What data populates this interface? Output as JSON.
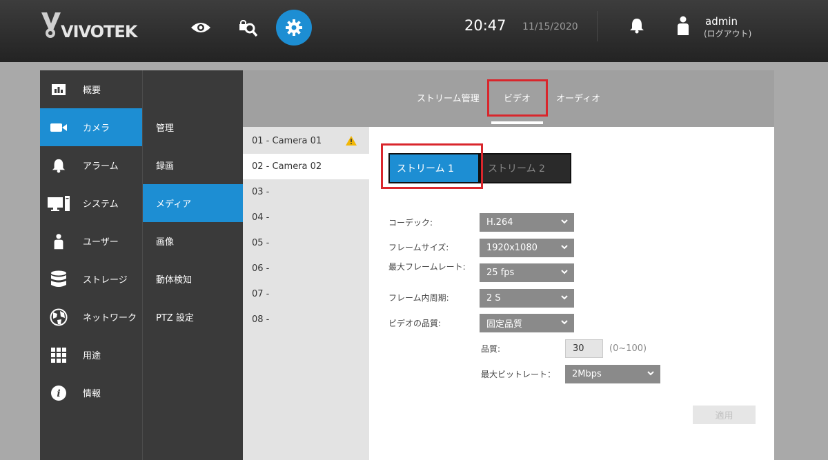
{
  "header": {
    "logo_text": "VIVOTEK",
    "time": "20:47",
    "date": "11/15/2020",
    "username": "admin",
    "logout_label": "(ログアウト)",
    "icons": [
      "eye-icon",
      "search-icon",
      "gear-icon",
      "bell-icon",
      "user-icon"
    ]
  },
  "colors": {
    "accent": "#1d8ed3",
    "highlight": "#d9262c",
    "header_bg": "#2e2e2e"
  },
  "nav_main": {
    "items": [
      {
        "label": "概要",
        "icon": "chart-icon"
      },
      {
        "label": "カメラ",
        "icon": "camera-icon"
      },
      {
        "label": "アラーム",
        "icon": "bell-icon"
      },
      {
        "label": "システム",
        "icon": "computer-icon"
      },
      {
        "label": "ユーザー",
        "icon": "user-icon"
      },
      {
        "label": "ストレージ",
        "icon": "database-icon"
      },
      {
        "label": "ネットワーク",
        "icon": "globe-icon"
      },
      {
        "label": "用途",
        "icon": "grid-icon"
      },
      {
        "label": "情報",
        "icon": "info-icon"
      }
    ],
    "active_index": 1
  },
  "nav_sub": {
    "items": [
      {
        "label": "管理"
      },
      {
        "label": "録画"
      },
      {
        "label": "メディア"
      },
      {
        "label": "画像"
      },
      {
        "label": "動体検知"
      },
      {
        "label": "PTZ 設定"
      }
    ],
    "active_index": 2
  },
  "tabs": {
    "items": [
      {
        "label": "ストリーム管理"
      },
      {
        "label": "ビデオ"
      },
      {
        "label": "オーディオ"
      }
    ],
    "active_index": 1
  },
  "cameras": {
    "items": [
      {
        "label": "01 - Camera 01"
      },
      {
        "label": "02 - Camera 02"
      },
      {
        "label": "03 -"
      },
      {
        "label": "04 -"
      },
      {
        "label": "05 -"
      },
      {
        "label": "06 -"
      },
      {
        "label": "07 -"
      },
      {
        "label": "08 -"
      }
    ],
    "active_index": 1
  },
  "streams": {
    "stream1": "ストリーム 1",
    "stream2": "ストリーム 2"
  },
  "form": {
    "codec_label": "コーデック:",
    "codec_value": "H.264",
    "frame_size_label": "フレームサイズ:",
    "frame_size_value": "1920x1080",
    "max_fps_label": "最大フレームレート:",
    "max_fps_value": "25 fps",
    "gop_label": "フレーム内周期:",
    "gop_value": "2 S",
    "quality_mode_label": "ビデオの品質:",
    "quality_mode_value": "固定品質",
    "quality_label": "品質:",
    "quality_value": "30",
    "quality_range": "(0~100)",
    "max_bitrate_label": "最大ビットレート：",
    "max_bitrate_value": "2Mbps",
    "apply_label": "適用"
  }
}
